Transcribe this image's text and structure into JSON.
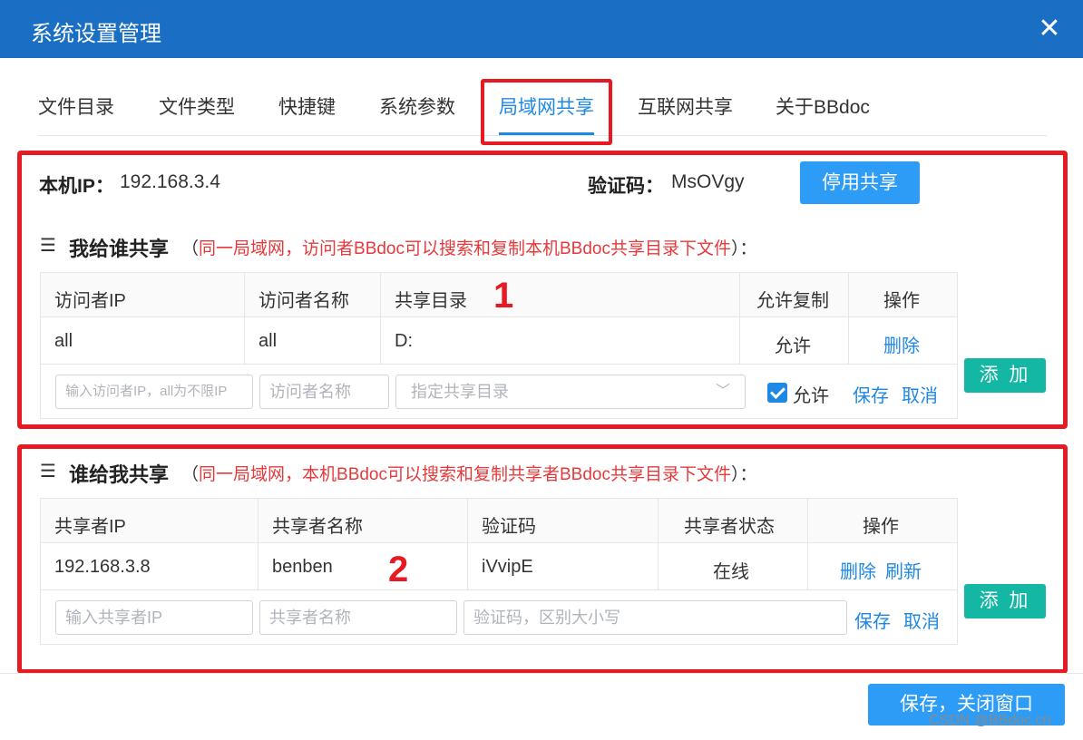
{
  "window": {
    "title": "系统设置管理",
    "close_label": "✕"
  },
  "tabs": [
    {
      "label": "文件目录"
    },
    {
      "label": "文件类型"
    },
    {
      "label": "快捷键"
    },
    {
      "label": "系统参数"
    },
    {
      "label": "局域网共享",
      "active": true
    },
    {
      "label": "互联网共享"
    },
    {
      "label": "关于BBdoc"
    }
  ],
  "local": {
    "ip_label": "本机IP：",
    "ip_value": "192.168.3.4",
    "code_label": "验证码：",
    "code_value": "MsOVgy",
    "disable_button": "停用共享"
  },
  "share_to": {
    "icon": "list-icon",
    "title": "我给谁共享",
    "desc_open": "（",
    "desc": "同一局域网，访问者BBdoc可以搜索和复制本机BBdoc共享目录下文件",
    "desc_close": "）：",
    "columns": [
      "访问者IP",
      "访问者名称",
      "共享目录",
      "允许复制",
      "操作"
    ],
    "rows": [
      {
        "ip": "all",
        "name": "all",
        "dir": "D:",
        "allow": "允许",
        "action": "删除"
      }
    ],
    "form": {
      "ip_placeholder": "输入访问者IP，all为不限IP",
      "name_placeholder": "访问者名称",
      "dir_placeholder": "指定共享目录",
      "allow_label": "允许",
      "save": "保存",
      "cancel": "取消"
    },
    "add_button": "添 加",
    "marker": "1"
  },
  "share_from": {
    "icon": "list-icon",
    "title": "谁给我共享",
    "desc_open": "（",
    "desc": "同一局域网，本机BBdoc可以搜索和复制共享者BBdoc共享目录下文件",
    "desc_close": "）：",
    "columns": [
      "共享者IP",
      "共享者名称",
      "验证码",
      "共享者状态",
      "操作"
    ],
    "rows": [
      {
        "ip": "192.168.3.8",
        "name": "benben",
        "code": "iVvipE",
        "status": "在线",
        "delete": "删除",
        "refresh": "刷新"
      }
    ],
    "form": {
      "ip_placeholder": "输入共享者IP",
      "name_placeholder": "共享者名称",
      "code_placeholder": "验证码，区别大小写",
      "save": "保存",
      "cancel": "取消"
    },
    "add_button": "添 加",
    "marker": "2"
  },
  "footer": {
    "save_close_button": "保存，关闭窗口",
    "watermark": "CSDN @BBdoc.cn"
  },
  "colors": {
    "title_bar": "#1a6fc4",
    "accent": "#1e88e5",
    "primary_button": "#2d9cf6",
    "add_button": "#13b7a3",
    "highlight_red": "#e61a23",
    "desc_red": "#e5393b"
  }
}
